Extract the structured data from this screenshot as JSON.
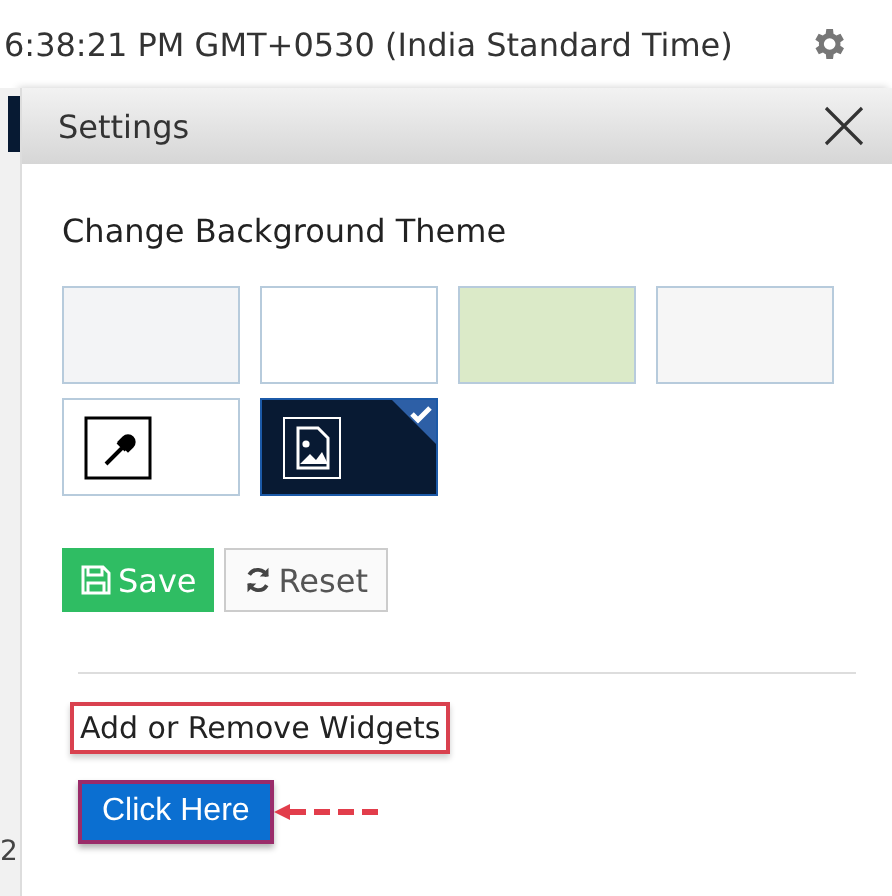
{
  "header": {
    "time": "6:38:21 PM GMT+0530 (India Standard Time)"
  },
  "background_fragment": {
    "text": "2"
  },
  "dialog": {
    "title": "Settings",
    "section_title": "Change Background Theme",
    "themes": [
      {
        "kind": "color",
        "color": "#f3f4f6",
        "selected": false
      },
      {
        "kind": "color",
        "color": "#ffffff",
        "selected": false
      },
      {
        "kind": "color",
        "color": "#dbeac8",
        "selected": false
      },
      {
        "kind": "color",
        "color": "#f6f6f6",
        "selected": false
      },
      {
        "kind": "picker",
        "selected": false
      },
      {
        "kind": "image",
        "selected": true
      }
    ],
    "buttons": [
      {
        "kind": "save",
        "label": "Save"
      },
      {
        "kind": "reset",
        "label": "Reset"
      }
    ],
    "widgets_label": "Add or Remove Widgets",
    "click_button": "Click Here"
  }
}
